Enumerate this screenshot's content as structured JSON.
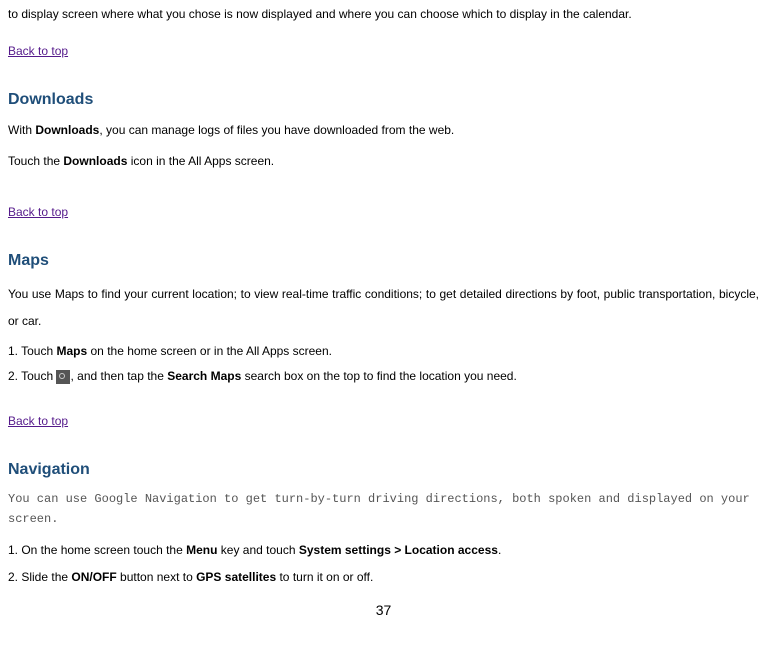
{
  "intro": "to display screen where what you chose is now displayed and where you can choose which to display in the calendar.",
  "backToTop": "Back to top",
  "downloads": {
    "heading": "Downloads",
    "p1_prefix": "With ",
    "p1_bold": "Downloads",
    "p1_suffix": ", you can manage logs of files you have downloaded from the web.",
    "p2_prefix": "Touch the ",
    "p2_bold": "Downloads",
    "p2_suffix": " icon in the All Apps screen."
  },
  "maps": {
    "heading": "Maps",
    "intro": "You use Maps to find your current location; to view real-time traffic conditions; to get detailed directions by foot, public transportation, bicycle, or car.",
    "s1_prefix": "1. Touch ",
    "s1_bold": "Maps",
    "s1_suffix": " on the home screen or in the All Apps screen.",
    "s2_prefix": "2. Touch  ",
    "s2_mid": ", and then tap the ",
    "s2_bold": "Search Maps",
    "s2_suffix": " search box on the top to find the location you need."
  },
  "navigation": {
    "heading": "Navigation",
    "desc": "You can use Google Navigation to get turn-by-turn driving directions, both spoken and displayed on your screen.",
    "s1_prefix": "1. On the home screen touch the ",
    "s1_bold1": "Menu",
    "s1_mid": " key and touch ",
    "s1_bold2": "System settings > Location access",
    "s1_suffix": ".",
    "s2_prefix": "2. Slide the ",
    "s2_bold1": "ON/OFF",
    "s2_mid": " button next to ",
    "s2_bold2": "GPS satellites",
    "s2_suffix": " to turn it on or off."
  },
  "pageNumber": "37"
}
